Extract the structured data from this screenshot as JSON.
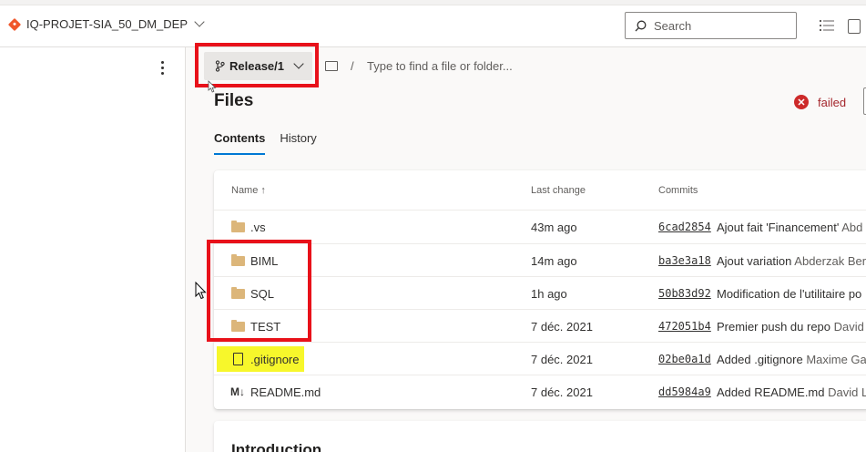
{
  "header": {
    "repo_name": "IQ-PROJET-SIA_50_DM_DEP",
    "search_placeholder": "Search"
  },
  "branch": {
    "name": "Release/1",
    "path_placeholder": "Type to find a file or folder...",
    "separator": "/"
  },
  "files": {
    "title": "Files",
    "status": "failed",
    "tabs": [
      {
        "label": "Contents",
        "active": true
      },
      {
        "label": "History",
        "active": false
      }
    ]
  },
  "table": {
    "columns": [
      "Name ↑",
      "Last change",
      "Commits"
    ],
    "rows": [
      {
        "name": ".vs",
        "type": "folder",
        "last_change": "43m ago",
        "commit": "6cad2854",
        "message": "Ajout fait 'Financement'",
        "author": "Abd"
      },
      {
        "name": "BIML",
        "type": "folder",
        "last_change": "14m ago",
        "commit": "ba3e3a18",
        "message": "Ajout variation",
        "author": "Abderzak Ber"
      },
      {
        "name": "SQL",
        "type": "folder",
        "last_change": "1h ago",
        "commit": "50b83d92",
        "message": "Modification de l'utilitaire po",
        "author": ""
      },
      {
        "name": "TEST",
        "type": "folder",
        "last_change": "7 déc. 2021",
        "commit": "472051b4",
        "message": "Premier push du repo",
        "author": "David"
      },
      {
        "name": ".gitignore",
        "type": "file",
        "last_change": "7 déc. 2021",
        "commit": "02be0a1d",
        "message": "Added .gitignore",
        "author": "Maxime Ga"
      },
      {
        "name": "README.md",
        "type": "markdown",
        "last_change": "7 déc. 2021",
        "commit": "dd5984a9",
        "message": "Added README.md",
        "author": "David Le"
      }
    ]
  },
  "readme": {
    "heading": "Introduction"
  },
  "colors": {
    "accent": "#0078d4",
    "annotation_red": "#e8111a",
    "highlight_yellow": "#f7f72b",
    "error": "#cd2a2a"
  }
}
